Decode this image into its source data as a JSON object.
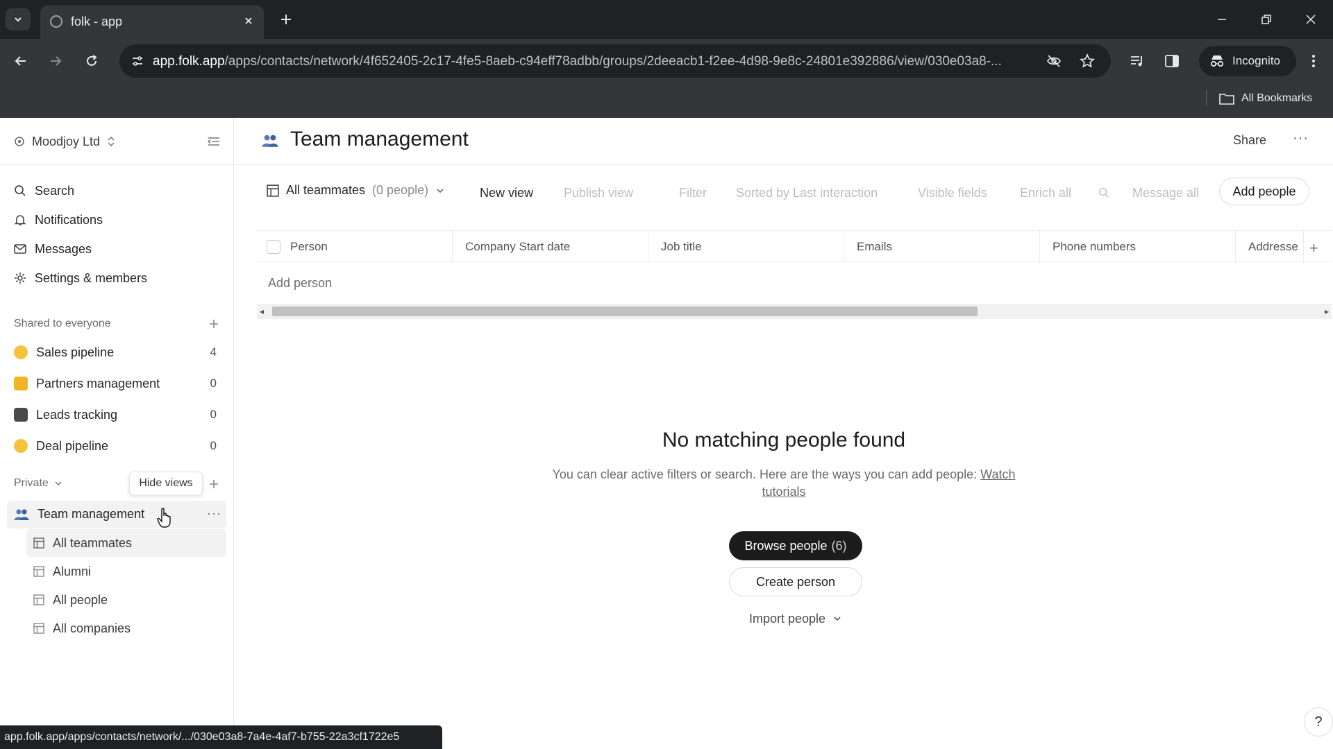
{
  "browser": {
    "tab_title": "folk - app",
    "url_host": "app.folk.app",
    "url_path": "/apps/contacts/network/4f652405-2c17-4fe5-8aeb-c94eff78adbb/groups/2deeacb1-f2ee-4d98-9e8c-24801e392886/view/030e03a8-...",
    "incognito_label": "Incognito",
    "all_bookmarks_label": "All Bookmarks",
    "status_url": "app.folk.app/apps/contacts/network/.../030e03a8-7a4e-4af7-b755-22a3cf1722e5"
  },
  "sidebar": {
    "workspace": "Moodjoy Ltd",
    "nav": [
      {
        "label": "Search",
        "icon": "search-icon"
      },
      {
        "label": "Notifications",
        "icon": "bell-icon"
      },
      {
        "label": "Messages",
        "icon": "mail-icon"
      },
      {
        "label": "Settings & members",
        "icon": "gear-icon"
      }
    ],
    "shared_title": "Shared to everyone",
    "shared_groups": [
      {
        "label": "Sales pipeline",
        "count": "4",
        "emoji_color": "#f5c33b"
      },
      {
        "label": "Partners management",
        "count": "0",
        "emoji_color": "#f0b429"
      },
      {
        "label": "Leads tracking",
        "count": "0",
        "emoji_color": "#4a4a4a"
      },
      {
        "label": "Deal pipeline",
        "count": "0",
        "emoji_color": "#f5c33b"
      }
    ],
    "private_title": "Private",
    "tooltip": "Hide views",
    "private_group": "Team management",
    "views": [
      {
        "label": "All teammates",
        "active": true
      },
      {
        "label": "Alumni"
      },
      {
        "label": "All people"
      },
      {
        "label": "All companies"
      }
    ]
  },
  "main": {
    "title": "Team management",
    "share_label": "Share",
    "view_name": "All teammates",
    "view_count": "(0 people)",
    "toolbar": {
      "new_view": "New view",
      "publish_view": "Publish view",
      "filter": "Filter",
      "sorted": "Sorted by Last interaction",
      "visible_fields": "Visible fields",
      "enrich_all": "Enrich all",
      "message_all": "Message all",
      "add_people": "Add people"
    },
    "columns": [
      "Person",
      "Company Start date",
      "Job title",
      "Emails",
      "Phone numbers",
      "Addresse"
    ],
    "add_person": "Add person",
    "empty": {
      "title": "No matching people found",
      "desc": "You can clear active filters or search. Here are the ways you can add people:",
      "link": "Watch tutorials",
      "browse_label": "Browse people",
      "browse_count": "(6)",
      "create_label": "Create person",
      "import_label": "Import people"
    },
    "help": "?"
  },
  "colors": {
    "accent_dark": "#1c1c1c",
    "chrome_bg": "#202124",
    "chrome_toolbar": "#35363a"
  }
}
